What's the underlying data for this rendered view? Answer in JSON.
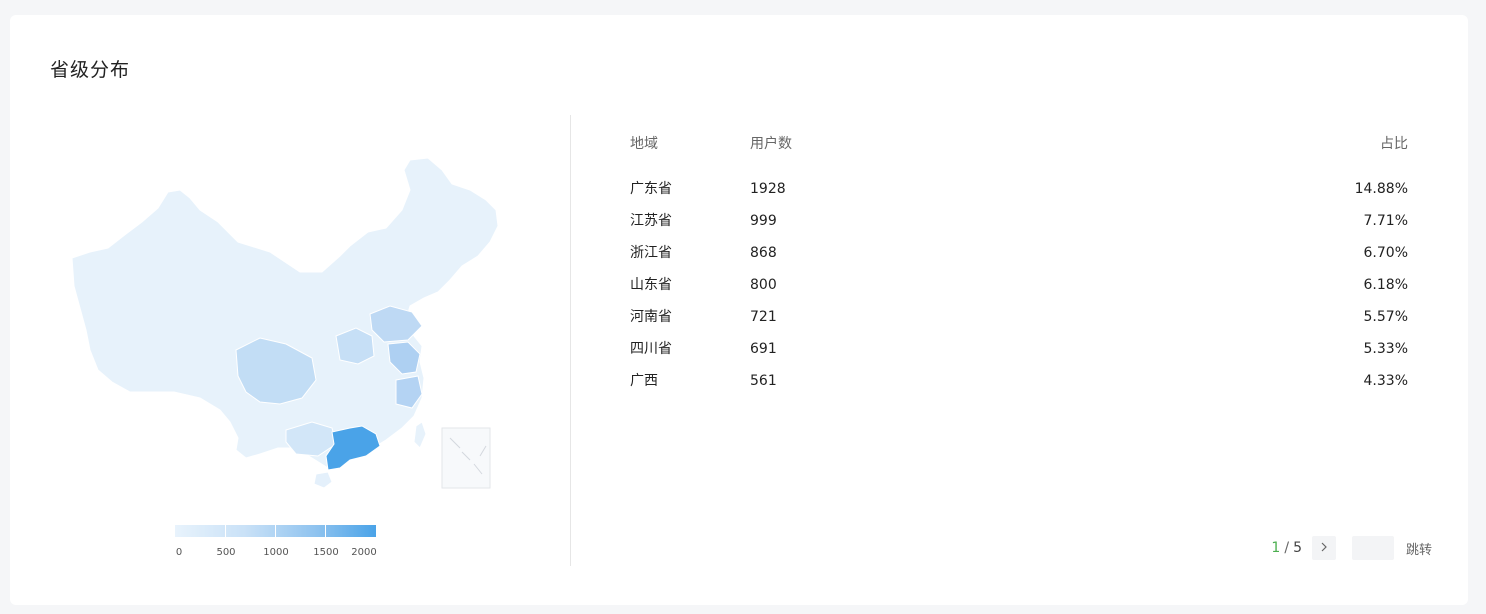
{
  "card": {
    "title": "省级分布"
  },
  "legend": {
    "labels": [
      "0",
      "500",
      "1000",
      "1500",
      "2000"
    ],
    "colors": {
      "min": "#e8f3fc",
      "max": "#4aa3e8"
    }
  },
  "table": {
    "headers": {
      "region": "地域",
      "users": "用户数",
      "ratio": "占比"
    },
    "rows": [
      {
        "region": "广东省",
        "users": "1928",
        "ratio": "14.88%"
      },
      {
        "region": "江苏省",
        "users": "999",
        "ratio": "7.71%"
      },
      {
        "region": "浙江省",
        "users": "868",
        "ratio": "6.70%"
      },
      {
        "region": "山东省",
        "users": "800",
        "ratio": "6.18%"
      },
      {
        "region": "河南省",
        "users": "721",
        "ratio": "5.57%"
      },
      {
        "region": "四川省",
        "users": "691",
        "ratio": "5.33%"
      },
      {
        "region": "广西",
        "users": "561",
        "ratio": "4.33%"
      }
    ]
  },
  "pager": {
    "current": "1",
    "separator": "/",
    "total": "5",
    "next_icon": "chevron-right-icon",
    "jump_label": "跳转",
    "jump_value": ""
  }
}
